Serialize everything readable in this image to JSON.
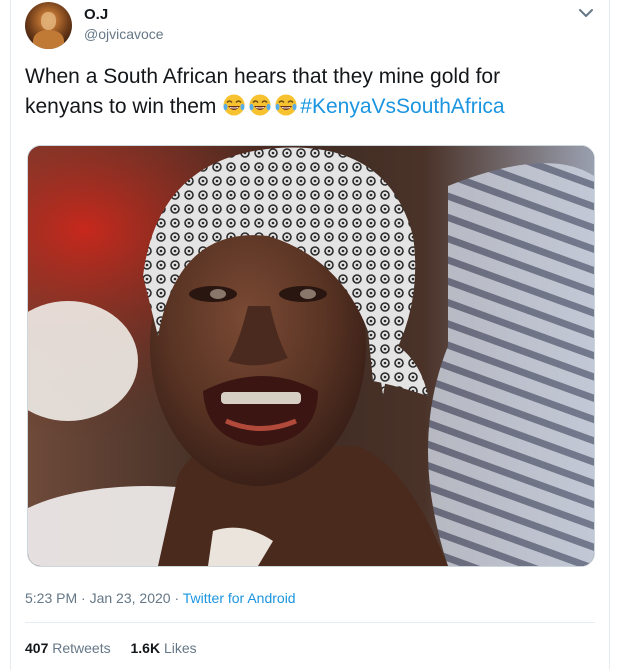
{
  "author": {
    "name": "O.J",
    "handle": "@ojvicavoce",
    "avatar": "avatar-image"
  },
  "menu_icon": "chevron-down-icon",
  "tweet": {
    "text_line1": "When a South African hears that they mine gold for",
    "text_line2": "kenyans to win them",
    "emojis": [
      "tears-of-joy-emoji",
      "tears-of-joy-emoji",
      "tears-of-joy-emoji"
    ],
    "hashtag": "#KenyaVsSouthAfrica",
    "media": "photo-elderly-woman-grimacing"
  },
  "meta": {
    "time": "5:23 PM",
    "date": "Jan 23, 2020",
    "separator": " · ",
    "source": "Twitter for Android"
  },
  "stats": {
    "retweets_count": "407",
    "retweets_label": "Retweets",
    "likes_count": "1.6K",
    "likes_label": "Likes"
  },
  "colors": {
    "link": "#1b95e0",
    "secondary_text": "#657786",
    "primary_text": "#14171a",
    "border": "#e6ecf0"
  }
}
